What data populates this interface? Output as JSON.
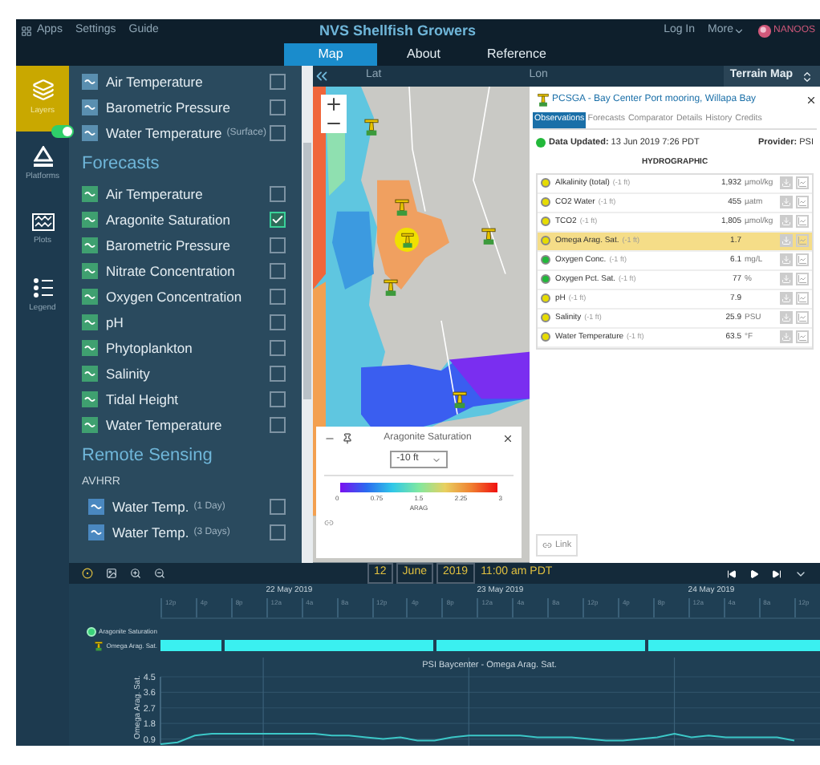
{
  "header": {
    "menu": [
      {
        "label": "Apps"
      },
      {
        "label": "Settings"
      },
      {
        "label": "Guide"
      }
    ],
    "title": "NVS Shellfish Growers",
    "login": "Log In",
    "more": "More",
    "logo_text": "NANOOS"
  },
  "nav_tabs": [
    {
      "label": "Map",
      "selected": true
    },
    {
      "label": "About",
      "selected": false
    },
    {
      "label": "Reference",
      "selected": false
    }
  ],
  "rail": [
    {
      "label": "Layers",
      "selected": true
    },
    {
      "label": "Platforms",
      "selected": false,
      "switch_on": true
    },
    {
      "label": "Plots",
      "selected": false
    },
    {
      "label": "Legend",
      "selected": false
    }
  ],
  "layers": {
    "items": [
      {
        "label": "Air Temperature",
        "checked": false
      },
      {
        "label": "Barometric Pressure",
        "checked": false
      },
      {
        "label": "Water Temperature",
        "note": "(Surface)",
        "checked": false
      }
    ],
    "sections": [
      {
        "title": "Forecasts",
        "items": [
          {
            "label": "Air Temperature",
            "checked": false
          },
          {
            "label": "Aragonite Saturation",
            "checked": true
          },
          {
            "label": "Barometric Pressure",
            "checked": false
          },
          {
            "label": "Nitrate Concentration",
            "checked": false
          },
          {
            "label": "Oxygen Concentration",
            "checked": false
          },
          {
            "label": "pH",
            "checked": false
          },
          {
            "label": "Phytoplankton",
            "checked": false
          },
          {
            "label": "Salinity",
            "checked": false
          },
          {
            "label": "Tidal Height",
            "checked": false
          },
          {
            "label": "Water Temperature",
            "checked": false
          }
        ]
      },
      {
        "title": "Remote Sensing",
        "subtitle": "AVHRR",
        "items": [
          {
            "label": "Water Temp.",
            "note": "(1 Day)",
            "checked": false
          },
          {
            "label": "Water Temp.",
            "note": "(3 Days)",
            "checked": false
          }
        ]
      }
    ]
  },
  "map_bar": {
    "lat": "Lat",
    "lon": "Lon",
    "basemap": "Terrain Map"
  },
  "legend": {
    "title": "Aragonite Saturation",
    "depth": "-10 ft",
    "ticks": [
      "0",
      "0.75",
      "1.5",
      "2.25",
      "3"
    ],
    "unit": "ARAG"
  },
  "popup": {
    "title": "PCSGA - Bay Center Port mooring, Willapa Bay",
    "tabs": [
      {
        "label": "Observations",
        "selected": true
      },
      {
        "label": "Forecasts",
        "selected": false
      },
      {
        "label": "Comparator",
        "selected": false
      },
      {
        "label": "Details",
        "selected": false
      },
      {
        "label": "History",
        "selected": false
      },
      {
        "label": "Credits",
        "selected": false
      }
    ],
    "updated": "**Data Updated:** 13 Jun 2019 7:26 PDT",
    "provider": "**Provider:** PSI",
    "section": "HYDROGRAPHIC",
    "rows": [
      {
        "name": "Alkalinity (total)",
        "depth": "(-1 ft)",
        "value": "1,932",
        "unit": "µmol/kg",
        "color": "#e6dc00",
        "selected": false
      },
      {
        "name": "CO2 Water",
        "depth": "(-1 ft)",
        "value": "455",
        "unit": "µatm",
        "color": "#e6dc00",
        "selected": false
      },
      {
        "name": "TCO2",
        "depth": "(-1 ft)",
        "value": "1,805",
        "unit": "µmol/kg",
        "color": "#e6dc00",
        "selected": false
      },
      {
        "name": "Omega Arag. Sat.",
        "depth": "(-1 ft)",
        "value": "1.7",
        "color": "#e6dc00",
        "selected": true
      },
      {
        "name": "Oxygen Conc.",
        "depth": "(-1 ft)",
        "value": "6.1",
        "unit": "mg/L",
        "color": "#22b83a",
        "selected": false
      },
      {
        "name": "Oxygen Pct. Sat.",
        "depth": "(-1 ft)",
        "value": "77",
        "unit": "%",
        "color": "#22b83a",
        "selected": false
      },
      {
        "name": "pH",
        "depth": "(-1 ft)",
        "value": "7.9",
        "color": "#e6dc00",
        "selected": false
      },
      {
        "name": "Salinity",
        "depth": "(-1 ft)",
        "value": "25.9",
        "unit": "PSU",
        "color": "#e6dc00",
        "selected": false
      },
      {
        "name": "Water Temperature",
        "depth": "(-1 ft)",
        "value": "63.5",
        "unit": "°F",
        "color": "#e6dc00",
        "selected": false
      }
    ],
    "link": "Link"
  },
  "timeline": {
    "day": "12",
    "month": "June",
    "year": "2019",
    "time": "11:00 am PDT",
    "days": [
      "22 May 2019",
      "23 May 2019",
      "24 May 2019"
    ],
    "hour_ticks": [
      "12p",
      "4p",
      "8p",
      "12a",
      "4a",
      "8a",
      "12p",
      "4p",
      "8p",
      "12a",
      "4a",
      "8a",
      "12p",
      "4p",
      "8p",
      "12a",
      "4a",
      "8a",
      "12p"
    ],
    "layer_track": "Aragonite Saturation",
    "platform_track": "Omega Arag. Sat.",
    "chart_data": {
      "type": "line",
      "title": "PSI Baycenter - Omega Arag. Sat.",
      "ylabel": "Omega Arag. Sat.",
      "categories": [
        null,
        null,
        null,
        null,
        null,
        null,
        null,
        null,
        null,
        null,
        null,
        null,
        null,
        null,
        null,
        null,
        null,
        null,
        null,
        null,
        null,
        null,
        null,
        null,
        null,
        null,
        null,
        null,
        null,
        null,
        null,
        null,
        null,
        null,
        null,
        null,
        null,
        null
      ],
      "series": [
        {
          "color": "#3cc8c8",
          "values": [
            0.6,
            0.7,
            1.1,
            1.2,
            1.2,
            1.2,
            1.2,
            1.2,
            1.2,
            1.2,
            1.1,
            1.1,
            1.0,
            0.9,
            1.0,
            0.8,
            0.8,
            1.0,
            1.1,
            1.1,
            1.1,
            1.1,
            1.0,
            1.0,
            1.0,
            0.9,
            0.8,
            0.8,
            0.9,
            1.0,
            1.2,
            1.0,
            1.1,
            1.0,
            1.0,
            1.0,
            1.0,
            0.8
          ]
        }
      ],
      "grid": true,
      "ylim": [
        0.6,
        4.5
      ],
      "yticks": [
        0.9,
        1.8,
        2.7,
        3.6,
        4.5
      ]
    }
  }
}
